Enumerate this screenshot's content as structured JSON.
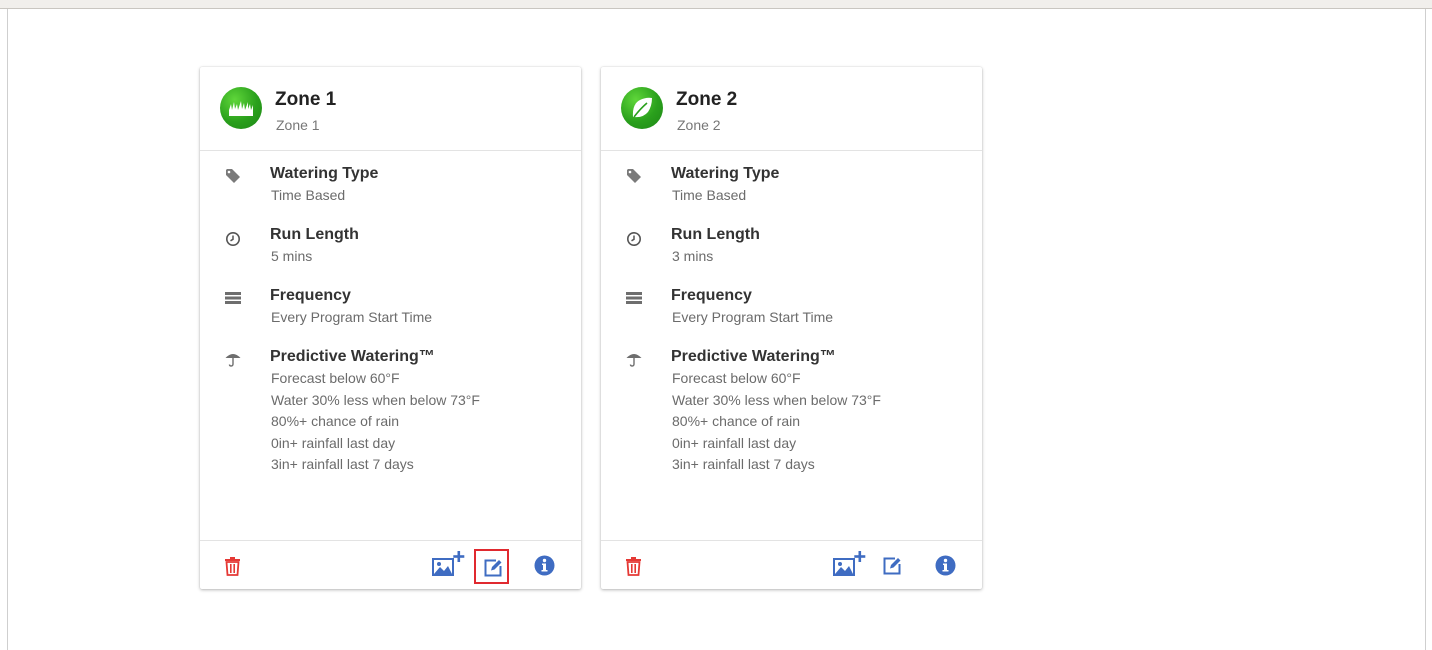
{
  "cards": [
    {
      "title": "Zone 1",
      "subtitle": "Zone 1",
      "avatar_icon": "grass-icon",
      "items": [
        {
          "icon": "tag-icon",
          "title": "Watering Type",
          "lines": [
            "Time Based"
          ]
        },
        {
          "icon": "clock-icon",
          "title": "Run Length",
          "lines": [
            "5 mins"
          ]
        },
        {
          "icon": "list-icon",
          "title": "Frequency",
          "lines": [
            "Every Program Start Time"
          ]
        },
        {
          "icon": "umbrella-icon",
          "title": "Predictive Watering™",
          "lines": [
            "Forecast below 60°F",
            "Water 30% less when below 73°F",
            "80%+ chance of rain",
            "0in+ rainfall last day",
            "3in+ rainfall last 7 days"
          ]
        }
      ],
      "edit_highlighted": true
    },
    {
      "title": "Zone 2",
      "subtitle": "Zone 2",
      "avatar_icon": "leaf-icon",
      "items": [
        {
          "icon": "tag-icon",
          "title": "Watering Type",
          "lines": [
            "Time Based"
          ]
        },
        {
          "icon": "clock-icon",
          "title": "Run Length",
          "lines": [
            "3 mins"
          ]
        },
        {
          "icon": "list-icon",
          "title": "Frequency",
          "lines": [
            "Every Program Start Time"
          ]
        },
        {
          "icon": "umbrella-icon",
          "title": "Predictive Watering™",
          "lines": [
            "Forecast below 60°F",
            "Water 30% less when below 73°F",
            "80%+ chance of rain",
            "0in+ rainfall last day",
            "3in+ rainfall last 7 days"
          ]
        }
      ],
      "edit_highlighted": false
    }
  ],
  "colors": {
    "avatar_green": "#2aa01c",
    "delete_red": "#e53935",
    "action_blue": "#3f6cc2",
    "highlight_red": "#e0292f"
  }
}
